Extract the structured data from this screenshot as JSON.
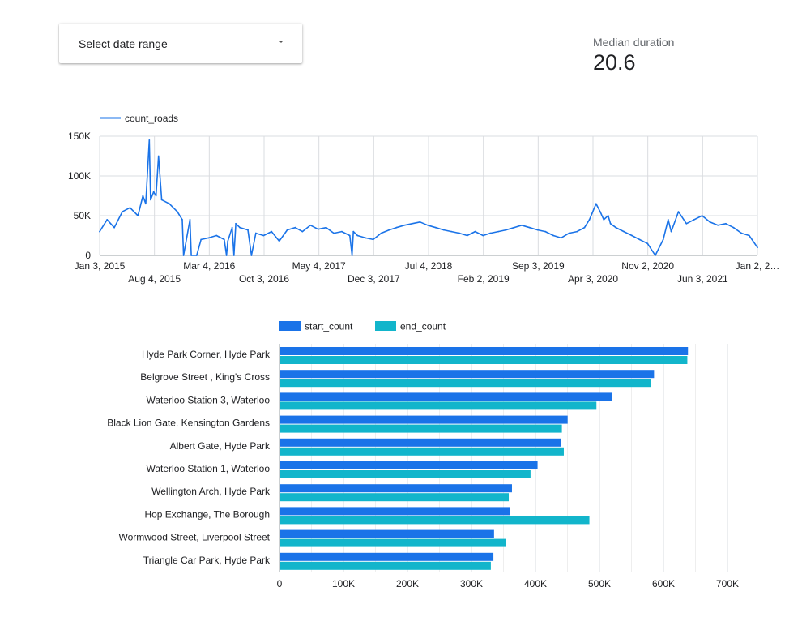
{
  "controls": {
    "date_range_label": "Select date range"
  },
  "scorecard": {
    "label": "Median duration",
    "value": "20.6"
  },
  "chart_data": [
    {
      "type": "line",
      "title": "",
      "xlabel": "",
      "ylabel": "",
      "series": [
        {
          "name": "count_roads",
          "color": "#1a73e8",
          "x": [
            "2015-01-03",
            "2015-02-01",
            "2015-03-01",
            "2015-04-01",
            "2015-05-01",
            "2015-06-01",
            "2015-06-20",
            "2015-07-01",
            "2015-07-15",
            "2015-07-20",
            "2015-08-01",
            "2015-08-10",
            "2015-08-20",
            "2015-09-01",
            "2015-10-01",
            "2015-11-01",
            "2015-11-20",
            "2015-11-25",
            "2015-12-20",
            "2015-12-25",
            "2016-01-15",
            "2016-02-01",
            "2016-03-01",
            "2016-04-01",
            "2016-05-01",
            "2016-05-10",
            "2016-05-15",
            "2016-06-01",
            "2016-06-08",
            "2016-06-15",
            "2016-07-01",
            "2016-08-01",
            "2016-08-15",
            "2016-09-01",
            "2016-10-01",
            "2016-11-01",
            "2016-12-01",
            "2017-01-01",
            "2017-02-01",
            "2017-03-01",
            "2017-04-01",
            "2017-05-01",
            "2017-06-01",
            "2017-07-01",
            "2017-08-01",
            "2017-09-01",
            "2017-09-10",
            "2017-09-15",
            "2017-10-01",
            "2017-11-01",
            "2017-12-01",
            "2018-01-01",
            "2018-02-01",
            "2018-03-01",
            "2018-04-01",
            "2018-05-01",
            "2018-06-01",
            "2018-07-01",
            "2018-08-01",
            "2018-09-01",
            "2018-10-01",
            "2018-11-01",
            "2018-12-01",
            "2019-01-01",
            "2019-02-01",
            "2019-03-01",
            "2019-04-01",
            "2019-05-01",
            "2019-06-01",
            "2019-07-01",
            "2019-08-01",
            "2019-09-01",
            "2019-10-01",
            "2019-11-01",
            "2019-12-01",
            "2020-01-01",
            "2020-02-01",
            "2020-03-01",
            "2020-03-20",
            "2020-04-15",
            "2020-05-01",
            "2020-05-15",
            "2020-06-01",
            "2020-06-10",
            "2020-07-01",
            "2020-08-01",
            "2020-09-01",
            "2020-10-01",
            "2020-11-01",
            "2020-12-01",
            "2021-01-01",
            "2021-01-20",
            "2021-02-01",
            "2021-03-01",
            "2021-04-01",
            "2021-05-01",
            "2021-06-01",
            "2021-07-01",
            "2021-08-01",
            "2021-09-01",
            "2021-10-01",
            "2021-11-01",
            "2021-12-01",
            "2022-01-02"
          ],
          "values": [
            30000,
            45000,
            35000,
            55000,
            60000,
            50000,
            75000,
            65000,
            145000,
            70000,
            80000,
            75000,
            125000,
            70000,
            65000,
            55000,
            45000,
            0,
            45000,
            0,
            0,
            20000,
            22000,
            25000,
            20000,
            0,
            18000,
            35000,
            0,
            40000,
            35000,
            32000,
            0,
            28000,
            25000,
            30000,
            18000,
            32000,
            35000,
            30000,
            38000,
            33000,
            35000,
            28000,
            30000,
            25000,
            0,
            30000,
            25000,
            22000,
            20000,
            28000,
            32000,
            35000,
            38000,
            40000,
            42000,
            38000,
            35000,
            32000,
            30000,
            28000,
            25000,
            30000,
            25000,
            28000,
            30000,
            32000,
            35000,
            38000,
            35000,
            32000,
            30000,
            25000,
            22000,
            28000,
            30000,
            35000,
            45000,
            65000,
            55000,
            45000,
            50000,
            40000,
            35000,
            30000,
            25000,
            20000,
            15000,
            0,
            20000,
            45000,
            30000,
            55000,
            40000,
            45000,
            50000,
            42000,
            38000,
            40000,
            35000,
            28000,
            25000,
            10000
          ]
        }
      ],
      "xaxis_ticks": [
        "Jan 3, 2015",
        "Aug 4, 2015",
        "Mar 4, 2016",
        "Oct 3, 2016",
        "May 4, 2017",
        "Dec 3, 2017",
        "Jul 4, 2018",
        "Feb 2, 2019",
        "Sep 3, 2019",
        "Apr 3, 2020",
        "Nov 2, 2020",
        "Jun 3, 2021",
        "Jan 2, 2…"
      ],
      "xaxis_tick_dates": [
        "2015-01-03",
        "2015-08-04",
        "2016-03-04",
        "2016-10-03",
        "2017-05-04",
        "2017-12-03",
        "2018-07-04",
        "2019-02-02",
        "2019-09-03",
        "2020-04-03",
        "2020-11-02",
        "2021-06-03",
        "2022-01-02"
      ],
      "yaxis_ticks": [
        {
          "value": 0,
          "label": "0"
        },
        {
          "value": 50000,
          "label": "50K"
        },
        {
          "value": 100000,
          "label": "100K"
        },
        {
          "value": 150000,
          "label": "150K"
        }
      ],
      "ylim": [
        0,
        150000
      ],
      "grid": true,
      "legend": "top-left"
    },
    {
      "type": "bar",
      "orientation": "horizontal",
      "title": "",
      "xlabel": "",
      "ylabel": "",
      "categories": [
        "Hyde Park Corner, Hyde Park",
        "Belgrove Street , King's Cross",
        "Waterloo Station 3, Waterloo",
        "Black Lion Gate, Kensington Gardens",
        "Albert Gate, Hyde Park",
        "Waterloo Station 1, Waterloo",
        "Wellington Arch, Hyde Park",
        "Hop Exchange, The Borough",
        "Wormwood Street, Liverpool Street",
        "Triangle Car Park, Hyde Park"
      ],
      "series": [
        {
          "name": "start_count",
          "color": "#1a73e8",
          "values": [
            637000,
            584000,
            518000,
            449000,
            439000,
            402000,
            362000,
            359000,
            334000,
            333000
          ]
        },
        {
          "name": "end_count",
          "color": "#12b5cb",
          "values": [
            636000,
            579000,
            494000,
            440000,
            443000,
            391000,
            357000,
            483000,
            353000,
            329000
          ]
        }
      ],
      "xaxis_ticks": [
        {
          "value": 0,
          "label": "0"
        },
        {
          "value": 100000,
          "label": "100K"
        },
        {
          "value": 200000,
          "label": "200K"
        },
        {
          "value": 300000,
          "label": "300K"
        },
        {
          "value": 400000,
          "label": "400K"
        },
        {
          "value": 500000,
          "label": "500K"
        },
        {
          "value": 600000,
          "label": "600K"
        },
        {
          "value": 700000,
          "label": "700K"
        }
      ],
      "xlim": [
        0,
        700000
      ],
      "grid": true,
      "legend": "top-left"
    }
  ]
}
